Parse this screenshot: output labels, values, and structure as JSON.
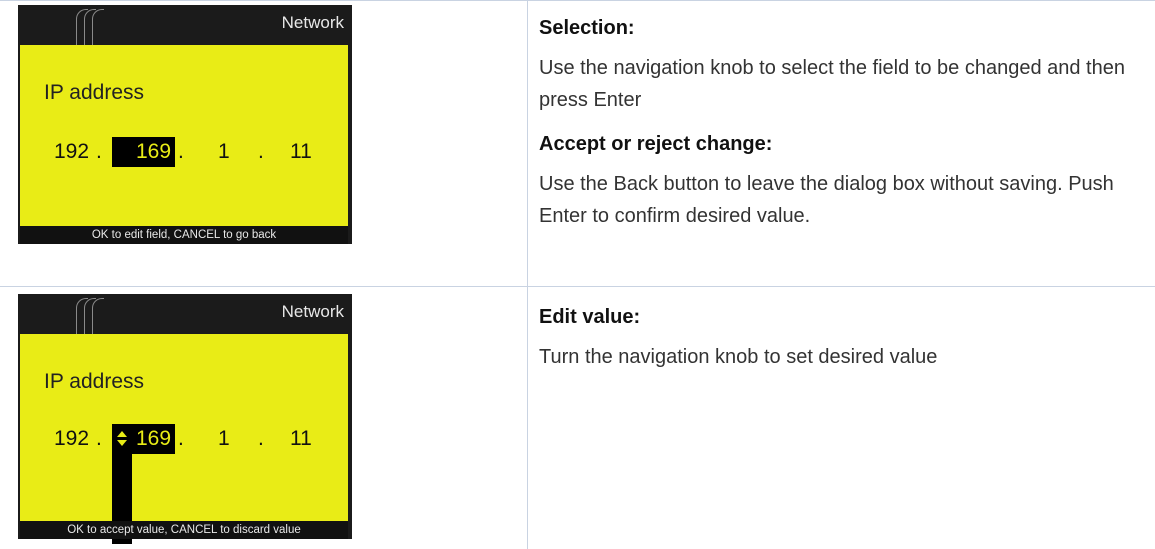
{
  "rows": [
    {
      "screen": {
        "header_title": "Network",
        "field_label": "IP address",
        "ip": {
          "o1": "192",
          "o2": "169",
          "o3": "1",
          "o4": "11",
          "dot": "."
        },
        "footer": "OK to edit field, CANCEL to go back",
        "mode": "select"
      },
      "sections": [
        {
          "heading": "Selection:",
          "text": "Use the navigation knob to select the field to be changed and then press Enter"
        },
        {
          "heading": "Accept or reject change:",
          "text": "Use the Back button to leave the dialog box without saving. Push Enter to confirm desired value."
        }
      ]
    },
    {
      "screen": {
        "header_title": "Network",
        "field_label": "IP address",
        "ip": {
          "o1": "192",
          "o2": "169",
          "o3": "1",
          "o4": "11",
          "dot": "."
        },
        "footer": "OK to accept value, CANCEL to discard value",
        "mode": "edit"
      },
      "sections": [
        {
          "heading": "Edit value:",
          "text": "Turn the navigation knob to set desired value"
        }
      ]
    }
  ],
  "colors": {
    "screen_bg": "#e9ec16",
    "frame": "#1b1b1b",
    "grid": "#c9d3e2"
  }
}
